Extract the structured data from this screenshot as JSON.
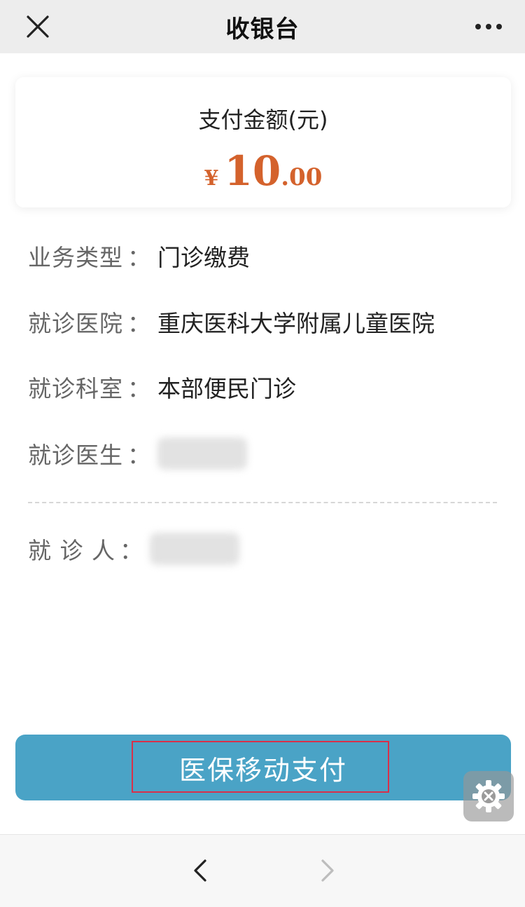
{
  "header": {
    "title": "收银台",
    "close_icon": "close-icon",
    "more_icon": "more-dots-icon"
  },
  "amount": {
    "label": "支付金额(元)",
    "currency_symbol": "¥",
    "integer_part": "10",
    "decimal_part": ".00",
    "color": "#d4622c"
  },
  "info": {
    "business_type": {
      "label": "业务类型",
      "value": "门诊缴费"
    },
    "hospital": {
      "label": "就诊医院",
      "value": "重庆医科大学附属儿童医院"
    },
    "department": {
      "label": "就诊科室",
      "value": "本部便民门诊"
    },
    "doctor": {
      "label": "就诊医生"
    },
    "patient": {
      "label": "就 诊 人"
    },
    "colon": "："
  },
  "pay_button": {
    "label": "医保移动支付",
    "color": "#4aa3c6"
  },
  "highlight_color": "#d9304a",
  "floating_tool_icon": "settings-gear-icon",
  "bottom_nav": {
    "back_icon": "chevron-left-icon",
    "forward_icon": "chevron-right-icon"
  }
}
